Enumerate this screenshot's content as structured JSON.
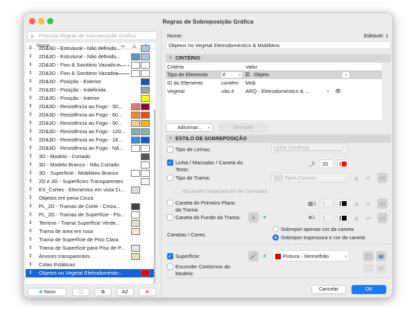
{
  "window": {
    "title": "Regras de Sobreposição Gráfica"
  },
  "sidebar": {
    "search_placeholder": "Procurar Regras de Sobreposição Gráfica",
    "column_name": "Nome",
    "rows": [
      {
        "name": "2D&3D - Estrutural - Não definido...",
        "a": null,
        "b": "#a9c8de",
        "line": null
      },
      {
        "name": "2D&3D - Estrutural - Não definido...",
        "a": "#5f97bf",
        "b": "#a9c8de",
        "line": null
      },
      {
        "name": "2D&3D - Fixo & Sanitário Vazado e...",
        "a": "#ffffff",
        "b": "#ffffff",
        "line": "dashed"
      },
      {
        "name": "2D&3D - Fixo & Sanitário Vazados",
        "a": "#ffffff",
        "b": "#ffffff",
        "line": "solid"
      },
      {
        "name": "2D&3D - Posição - Exterior",
        "a": null,
        "b": "#0b5cc4",
        "line": null
      },
      {
        "name": "2D&3D - Posição - Indefinida",
        "a": null,
        "b": "#9aa4aa",
        "line": null
      },
      {
        "name": "2D&3D - Posição - Interior",
        "a": null,
        "b": "#ffff00",
        "line": null
      },
      {
        "name": "2D&3D - Resistência ao Fogo -  30...",
        "a": "#e8727c",
        "b": "#8c0e26",
        "line": null
      },
      {
        "name": "2D&3D - Resistência ao Fogo -  60...",
        "a": "#f08a30",
        "b": "#e84e10",
        "line": null
      },
      {
        "name": "2D&3D - Resistência ao Fogo -  90...",
        "a": "#f2d08a",
        "b": "#f6b80c",
        "line": null
      },
      {
        "name": "2D&3D - Resistência ao Fogo - 120...",
        "a": "#7fb8a8",
        "b": "#7fb8a8",
        "line": null
      },
      {
        "name": "2D&3D - Resistência ao Fogo - 18...",
        "a": "#3a8ae8",
        "b": "#0b5cc4",
        "line": null
      },
      {
        "name": "2D&3D - Resistência ao Fogo - Nã...",
        "a": "#ffffff",
        "b": "#ffffff",
        "line": null
      },
      {
        "name": "3D - Modelo - Cortado",
        "a": null,
        "b": "#555555",
        "line": null
      },
      {
        "name": "3D - Modelo Branco - Não Cortado",
        "a": null,
        "b": "#ffffff",
        "line": null
      },
      {
        "name": "3D - Superfície - Mobiliário Branco",
        "a": "#ffffff",
        "b": "#ffffff",
        "line": null
      },
      {
        "name": "2D e 3D - Superfícies Transparentes",
        "a": null,
        "b": "#f4f6fb",
        "line": null
      },
      {
        "name": "EX_Cortes - Elementos em vista Ci...",
        "a": "#dcdcdc",
        "b": null,
        "line": null
      },
      {
        "name": "Objetos em pena Cinza",
        "a": null,
        "b": null,
        "line": null
      },
      {
        "name": "PL_2D - Tramas de Corte - Cinza...",
        "a": "#444444",
        "b": null,
        "line": null
      },
      {
        "name": "PL_2D - Tramas de Superfície - Pis...",
        "a": "#ffffff",
        "b": null,
        "line": null
      },
      {
        "name": "Terreno - Trama Superfície Verde...",
        "a": "#dfe0c4",
        "b": null,
        "line": null
      },
      {
        "name": "Trama de  área em rosa",
        "a": "#fde0c2",
        "b": null,
        "line": null
      },
      {
        "name": "Trama de Superfície de Piso Clara",
        "a": null,
        "b": null,
        "line": null
      },
      {
        "name": "Trama de Superfície para Piso de P...",
        "a": "#e4e4e4",
        "b": null,
        "line": null
      },
      {
        "name": "Árvores transparentes",
        "a": "#dfe0b4",
        "b": null,
        "line": null
      },
      {
        "name": "Cotas Estáticas",
        "a": null,
        "b": null,
        "line": null
      },
      {
        "name": "Objetos no Vegetal Eletrodoméstic...",
        "a": null,
        "b": "#ee0000",
        "line": null,
        "selected": true
      }
    ],
    "new_button": "Novo",
    "sort_button": "AZ"
  },
  "detail": {
    "name_label": "Nome:",
    "editable": "Editável: 1",
    "name_value": "Objetos no Vegetal Eletrodoméstico & Mobiliário",
    "criteria": {
      "section_title": "CRITÉRIO",
      "col_criterion": "Critério",
      "col_value": "Valor",
      "rows": [
        {
          "criterion": "Tipo de Elemento",
          "operator": "é",
          "value": "Objeto"
        },
        {
          "criterion": "ID do Elemento",
          "operator": "contém",
          "value": "Mob"
        },
        {
          "criterion": "Vegetal",
          "operator": "não é",
          "value": "ARQ - Eletrodoméstico & ..."
        }
      ],
      "add_button": "Adicionar...",
      "remove_button": "Remover"
    },
    "style": {
      "section_title": "ESTILO DE SOBREPOSIÇÃO",
      "line_type": {
        "label": "Tipo de Linhas:",
        "checked": false,
        "value": "Linha Contínua"
      },
      "line_pen": {
        "label": "Linha / Marcador / Caneta do Texto:",
        "checked": true,
        "pen": "20",
        "color": "#ee1100"
      },
      "fill_type": {
        "label": "Tipo de Trama:",
        "checked": false,
        "value": "Tijolo Comum"
      },
      "hide_separators": {
        "label": "Esconder Separadores de Camadas",
        "checked": false
      },
      "fg_pen": {
        "label": "Caneta do Primeiro Plano da Trama:",
        "checked": false,
        "pen": "1",
        "color": "#000000"
      },
      "bg_pen": {
        "label": "Caneta do Fundo da Trama:",
        "checked": false,
        "pen": "1",
        "color": "#000000"
      },
      "pens_label": "Canetas / Cores:",
      "radio_color_only": "Sobrepor apenas cor da caneta",
      "radio_weight_color": "Sobrepor espessura e cor da caneta",
      "radio_selected": "radio_weight_color",
      "surface": {
        "label": "Superfície:",
        "checked": true,
        "value": "Pintura - Vermelhão",
        "color": "#ee0000"
      },
      "hide_contours": {
        "label": "Esconder Contornos do Modelo:",
        "checked": false
      }
    },
    "cancel_button": "Cancelar",
    "ok_button": "OK",
    "accent": "#1a73e8"
  }
}
